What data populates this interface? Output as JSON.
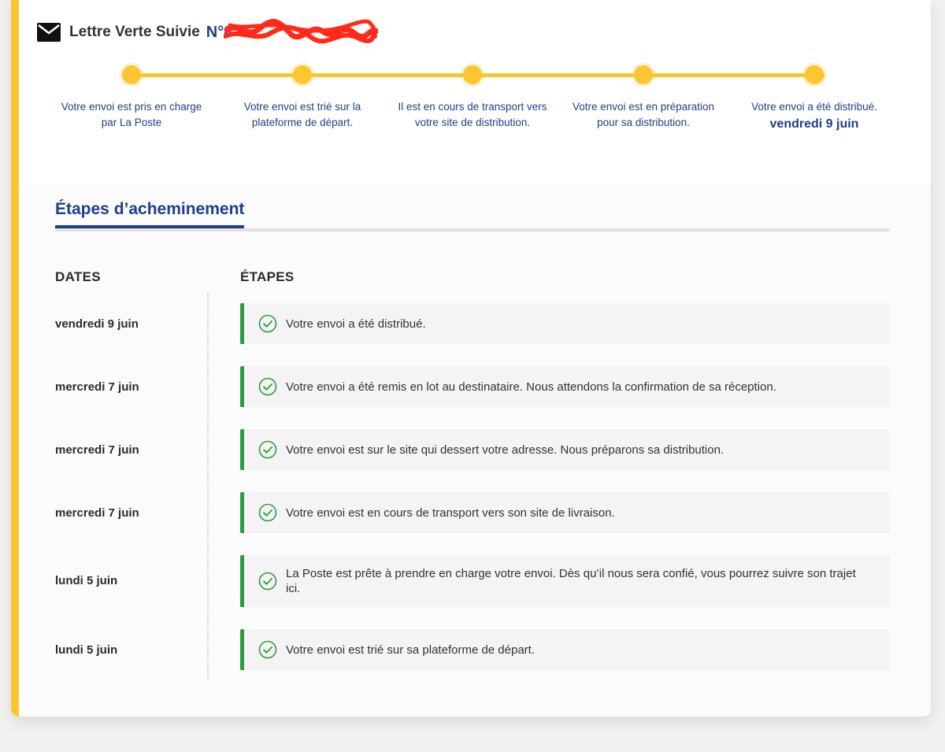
{
  "header": {
    "product_name": "Lettre Verte Suivie",
    "tracking_prefix": "N°8"
  },
  "timeline": {
    "steps": [
      {
        "label": "Votre envoi est pris en charge par La Poste"
      },
      {
        "label": "Votre envoi est trié sur la plateforme de départ."
      },
      {
        "label": "Il est en cours de transport vers votre site de distribution."
      },
      {
        "label": "Votre envoi est en préparation pour sa distribution."
      },
      {
        "label": "Votre envoi a été distribué.",
        "date": "vendredi 9 juin"
      }
    ]
  },
  "section": {
    "tab_title": "Étapes d’acheminement",
    "col_dates": "DATES",
    "col_steps": "ÉTAPES"
  },
  "events": [
    {
      "date": "vendredi 9 juin",
      "text": "Votre envoi a été distribué."
    },
    {
      "date": "mercredi 7 juin",
      "text": "Votre envoi a été remis en lot au destinataire. Nous attendons la confirmation de sa réception."
    },
    {
      "date": "mercredi 7 juin",
      "text": "Votre envoi est sur le site qui dessert votre adresse. Nous préparons sa distribution."
    },
    {
      "date": "mercredi 7 juin",
      "text": "Votre envoi est en cours de transport vers son site de livraison."
    },
    {
      "date": "lundi 5 juin",
      "text": "La Poste est prête à prendre en charge votre envoi. Dès qu’il nous sera confié, vous pourrez suivre son trajet ici."
    },
    {
      "date": "lundi 5 juin",
      "text": "Votre envoi est trié sur sa plateforme de départ."
    }
  ],
  "icons": {
    "mail": "envelope-icon",
    "check": "check-circle-icon"
  },
  "colors": {
    "brand_yellow": "#fcc630",
    "brand_blue": "#1f3f8a",
    "success_green": "#2e9b3e",
    "redaction_red": "#ff2a1a"
  }
}
